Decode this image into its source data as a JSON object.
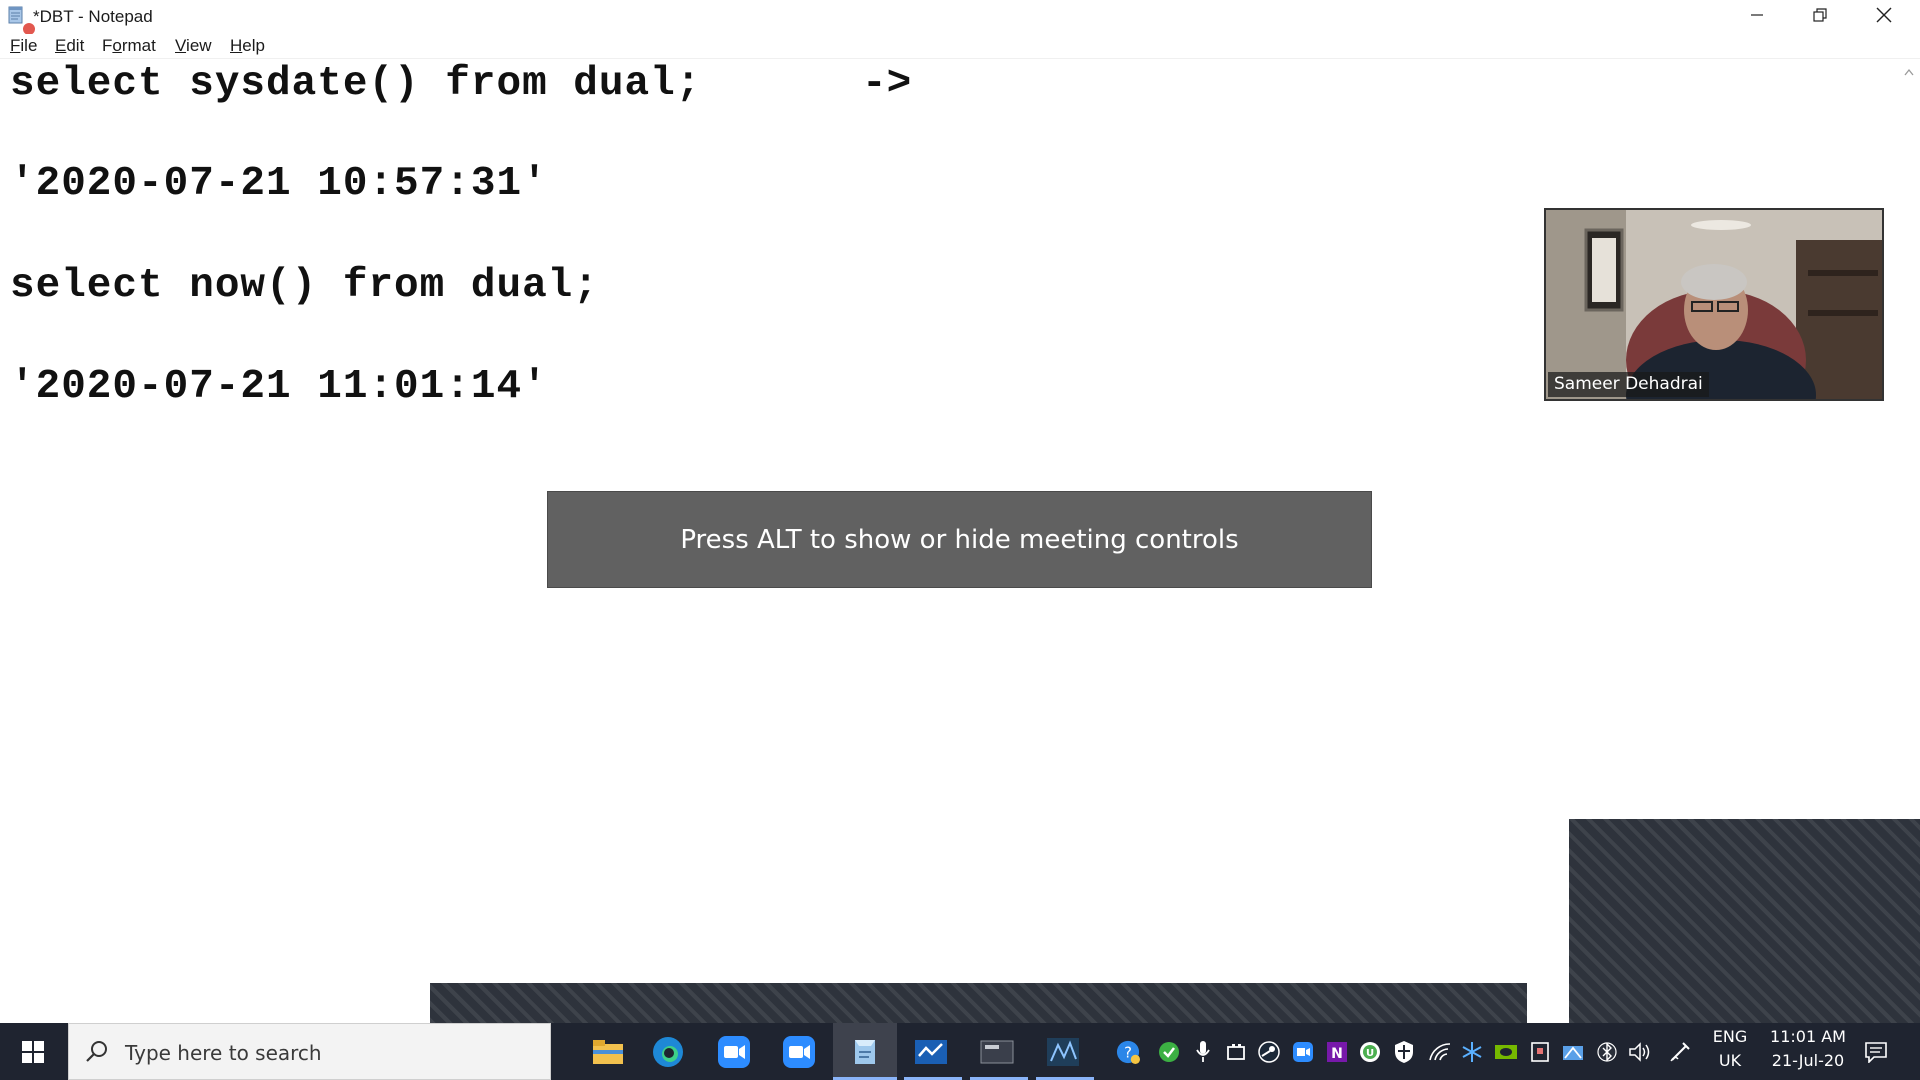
{
  "window": {
    "title": "*DBT - Notepad",
    "icon": "notepad-icon"
  },
  "menu": [
    {
      "label_first": "F",
      "label_rest": "ile"
    },
    {
      "label_first": "E",
      "label_rest": "dit"
    },
    {
      "label_first": "F",
      "label_rest": "ormat",
      "mnemonic_index": 1
    },
    {
      "label_first": "V",
      "label_rest": "iew"
    },
    {
      "label_first": "H",
      "label_rest": "elp"
    }
  ],
  "menu_labels": [
    "File",
    "Edit",
    "Format",
    "View",
    "Help"
  ],
  "editor": {
    "lines": [
      "select sysdate() from dual;",
      "'2020-07-21 10:57:31'",
      "select now() from dual;",
      "'2020-07-21 11:01:14'"
    ],
    "arrow": "->"
  },
  "meeting": {
    "toast": "Press ALT to show or hide meeting controls",
    "participant_name": "Sameer Dehadrai"
  },
  "taskbar": {
    "search_placeholder": "Type here to search",
    "language_top": "ENG",
    "language_bottom": "UK",
    "time": "11:01 AM",
    "date": "21-Jul-20",
    "accent_color": "#8ab4f8",
    "background_color": "#1f2430"
  }
}
